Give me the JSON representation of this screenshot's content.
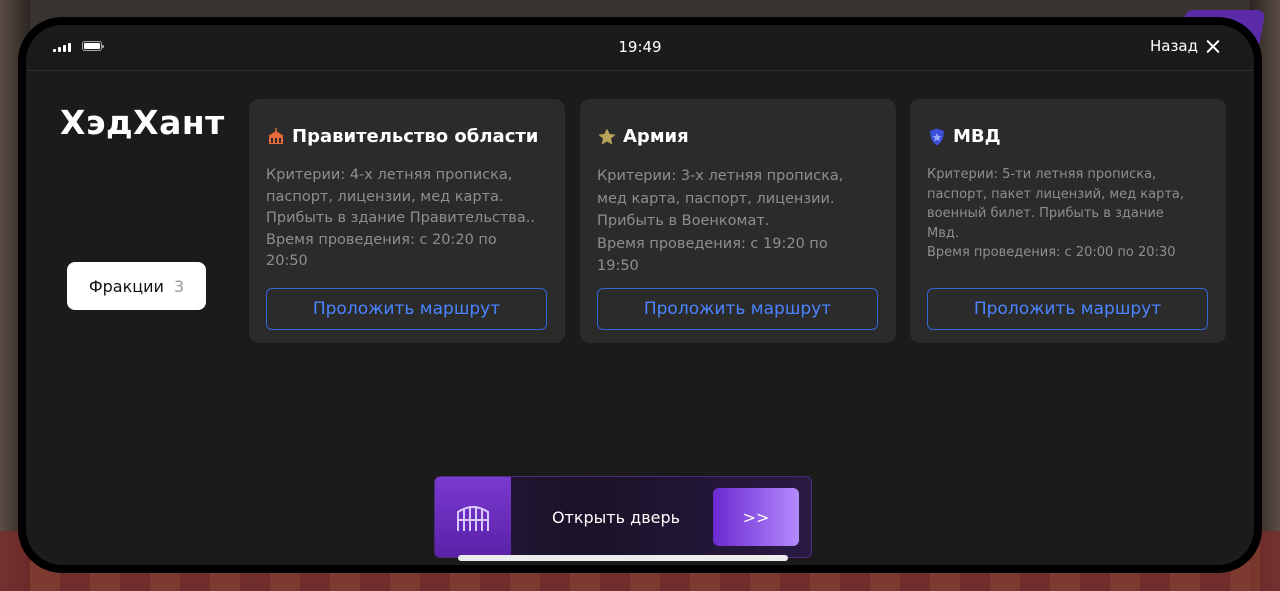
{
  "status_bar": {
    "time": "19:49"
  },
  "header": {
    "back_label": "Назад"
  },
  "app": {
    "title": "ХэдХант"
  },
  "filter": {
    "label": "Фракции",
    "count": "3"
  },
  "factions": [
    {
      "title": "Правительство области",
      "icon": "government-building-icon",
      "icon_color": "#e8693a",
      "lines": [
        "Критерии: 4-х летняя прописка,",
        "паспорт, лицензии, мед карта.",
        "Прибыть в здание Правительства..",
        "Время проведения: с 20:20 по",
        "20:50"
      ],
      "button_label": "Проложить маршрут"
    },
    {
      "title": "Армия",
      "icon": "star-icon",
      "icon_color": "#b7a35a",
      "lines": [
        "Критерии: 3-х летняя прописка,",
        "мед карта, паспорт, лицензии.",
        "Прибыть в Военкомат.",
        "Время проведения: с 19:20 по",
        "19:50"
      ],
      "button_label": "Проложить маршрут"
    },
    {
      "title": "МВД",
      "icon": "police-shield-icon",
      "icon_color": "#3b4fd8",
      "lines": [
        "Критерии: 5-ти летняя прописка,",
        "паспорт, пакет лицензий, мед карта,",
        "военный билет. Прибыть в здание",
        "Мвд.",
        "Время проведения: с 20:00 по 20:30"
      ],
      "button_label": "Проложить маршрут"
    }
  ],
  "door_action": {
    "label": "Открыть дверь",
    "go_label": ">>",
    "icon": "gate-icon"
  },
  "colors": {
    "accent": "#4a84ff",
    "door_purple": "#7a3ad0"
  }
}
